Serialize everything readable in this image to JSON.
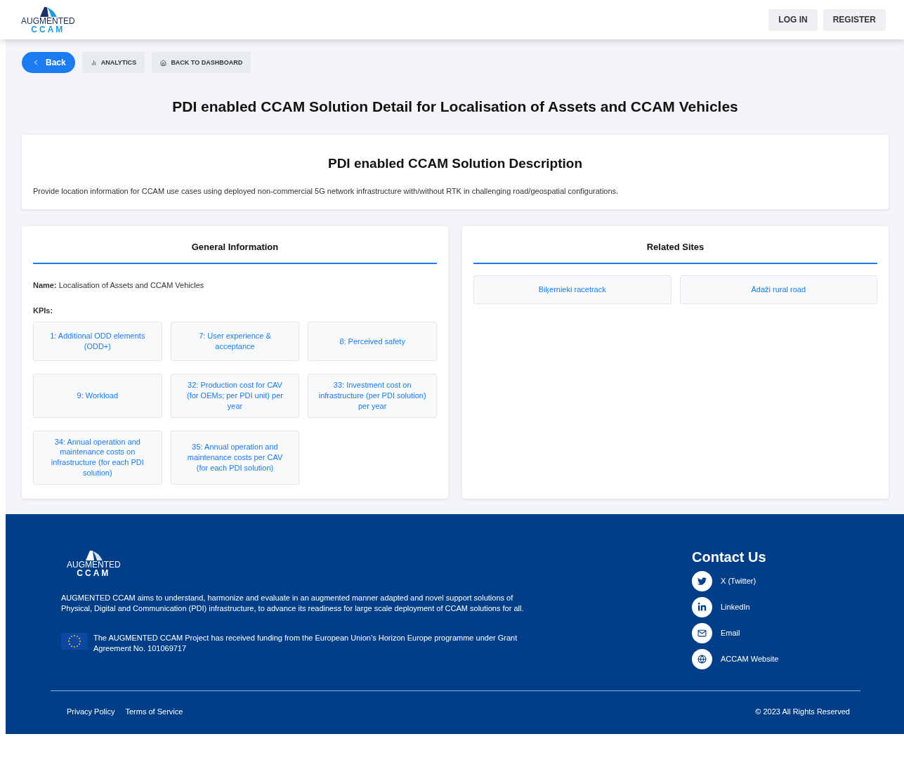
{
  "header": {
    "logo": {
      "line1": "AUGMENTED",
      "line2": "CCAM"
    },
    "buttons": [
      "LOG IN",
      "REGISTER"
    ]
  },
  "toolbar": {
    "back": "Back",
    "analytics": "ANALYTICS",
    "dashboard": "BACK TO DASHBOARD"
  },
  "title": "PDI enabled CCAM Solution Detail for Localisation of Assets and CCAM Vehicles",
  "description": {
    "title": "PDI enabled CCAM Solution Description",
    "text": "Provide location information for CCAM use cases using deployed non-commercial 5G network infrastructure with/without RTK in challenging road/geospatial configurations."
  },
  "general": {
    "title": "General Information",
    "name": "**Name:** Localisation of Assets and CCAM Vehicles",
    "kpis_label": "KPIs:",
    "kpis": [
      "1: Additional ODD elements (ODD+)",
      "7: User experience & acceptance",
      "8: Perceived safety",
      "9: Workload",
      "32: Production cost for CAV (for OEMs; per PDI unit) per year",
      "33: Investment cost on infrastructure (per PDI solution) per year",
      "34: Annual operation and maintenance costs on infrastructure (for each PDI solution)",
      "35: Annual operation and maintenance costs per CAV (for each PDI solution)"
    ]
  },
  "related": {
    "title": "Related Sites",
    "sites": [
      "Biķernieki racetrack",
      "Ādaži rural road"
    ]
  },
  "footer": {
    "logo": {
      "line1": "AUGMENTED",
      "line2": "CCAM"
    },
    "about": "AUGMENTED CCAM aims to understand, harmonize and evaluate in an augmented manner adapted and novel support solutions of Physical, Digital and Communication (PDI) infrastructure, to advance its readiness for large scale deployment of CCAM solutions for all.",
    "funding": "The AUGMENTED CCAM Project has received funding from the European Union’s Horizon Europe programme under Grant Agreement No. 101069717",
    "contact_title": "Contact Us",
    "contacts": [
      {
        "kind": "twitter",
        "label": "X (Twitter)"
      },
      {
        "kind": "linkedin",
        "label": "LinkedIn"
      },
      {
        "kind": "email",
        "label": "Email"
      },
      {
        "kind": "website",
        "label": "ACCAM Website"
      }
    ],
    "links": [
      "Privacy Policy",
      "Terms of Service"
    ],
    "copyright": "© 2023 All Rights Reserved"
  }
}
